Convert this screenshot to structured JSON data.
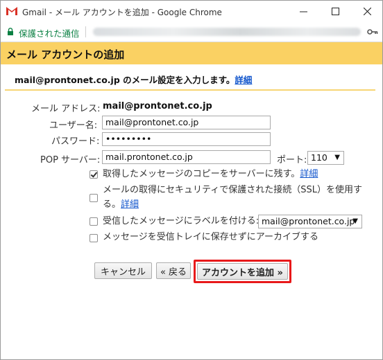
{
  "window": {
    "title": "Gmail - メール アカウントを追加 - Google Chrome",
    "minimize_glyph": "—",
    "maximize_glyph": "☐",
    "close_glyph": "✕"
  },
  "addressbar": {
    "secure_label": "保護された通信"
  },
  "page": {
    "header_title": "メール アカウントの追加",
    "intro_text": "mail@prontonet.co.jp のメール設定を入力します。",
    "intro_link": "詳細"
  },
  "form": {
    "email_label": "メール アドレス:",
    "email_value": "mail@prontonet.co.jp",
    "username_label": "ユーザー名:",
    "username_value": "mail@prontonet.co.jp",
    "password_label": "パスワード:",
    "password_value": "•••••••••",
    "pop_label": "POP サーバー:",
    "pop_value": "mail.prontonet.co.jp",
    "port_label": "ポート:",
    "port_value": "110",
    "options": [
      {
        "label": "取得したメッセージのコピーをサーバーに残す。",
        "link": "詳細",
        "checked": true
      },
      {
        "label_line1": "メールの取得にセキュリティで保護された接続（SSL）を使用す",
        "label_line2": "る。",
        "link": "詳細",
        "checked": false
      },
      {
        "label": "受信したメッセージにラベルを付ける:",
        "select_value": "mail@prontonet.co.jp",
        "checked": false
      },
      {
        "label": "メッセージを受信トレイに保存せずにアーカイブする",
        "checked": false
      }
    ]
  },
  "buttons": {
    "cancel": "キャンセル",
    "back": "« 戻る",
    "add_account": "アカウントを追加 »"
  },
  "colors": {
    "header_bg": "#fad163",
    "link": "#1155cc",
    "secure_green": "#0b8043",
    "highlight_red": "#e8191a"
  }
}
